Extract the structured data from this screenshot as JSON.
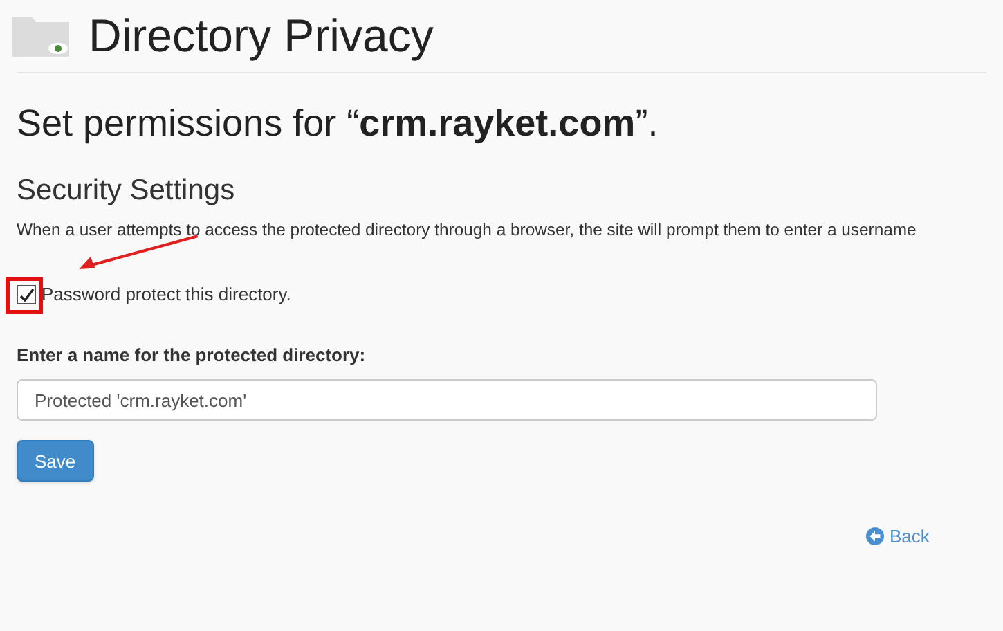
{
  "page_title": "Directory Privacy",
  "heading": "Set permissions for “**crm.rayket.com**”.",
  "section_title": "Security Settings",
  "description": "When a user attempts to access the protected directory through a browser, the site will prompt them to enter a username",
  "protect_option": {
    "label": "Password protect this directory.",
    "checked": true
  },
  "name_field": {
    "label": "Enter a name for the protected directory:",
    "value": "Protected 'crm.rayket.com'"
  },
  "buttons": [
    "Save"
  ],
  "back_link": "Back"
}
